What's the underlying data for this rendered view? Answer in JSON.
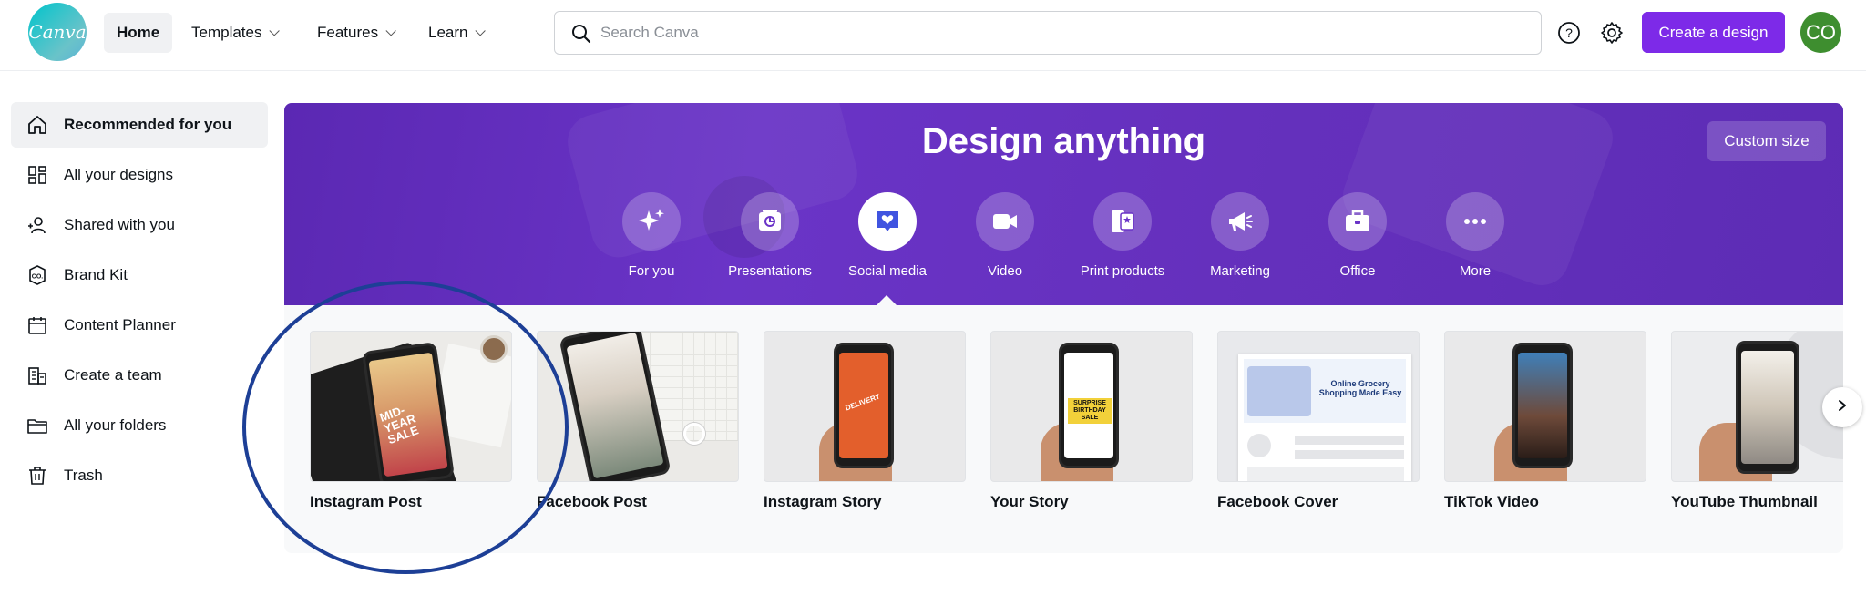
{
  "header": {
    "logo_text": "Canva",
    "nav": [
      {
        "label": "Home",
        "active": true,
        "dropdown": false
      },
      {
        "label": "Templates",
        "active": false,
        "dropdown": true
      },
      {
        "label": "Features",
        "active": false,
        "dropdown": true
      },
      {
        "label": "Learn",
        "active": false,
        "dropdown": true
      }
    ],
    "search_placeholder": "Search Canva",
    "create_label": "Create a design",
    "avatar_initials": "CO"
  },
  "sidebar": {
    "items": [
      {
        "label": "Recommended for you",
        "icon": "home-icon",
        "active": true
      },
      {
        "label": "All your designs",
        "icon": "grid-icon",
        "active": false
      },
      {
        "label": "Shared with you",
        "icon": "users-icon",
        "active": false
      },
      {
        "label": "Brand Kit",
        "icon": "brand-kit-icon",
        "active": false
      },
      {
        "label": "Content Planner",
        "icon": "calendar-icon",
        "active": false
      },
      {
        "label": "Create a team",
        "icon": "team-icon",
        "active": false
      },
      {
        "label": "All your folders",
        "icon": "folder-icon",
        "active": false
      },
      {
        "label": "Trash",
        "icon": "trash-icon",
        "active": false
      }
    ]
  },
  "hero": {
    "title": "Design anything",
    "custom_size_label": "Custom size",
    "categories": [
      {
        "label": "For you",
        "icon": "sparkle-icon",
        "active": false
      },
      {
        "label": "Presentations",
        "icon": "presentation-icon",
        "active": false
      },
      {
        "label": "Social media",
        "icon": "heart-chat-icon",
        "active": true
      },
      {
        "label": "Video",
        "icon": "video-camera-icon",
        "active": false
      },
      {
        "label": "Print products",
        "icon": "print-icon",
        "active": false
      },
      {
        "label": "Marketing",
        "icon": "megaphone-icon",
        "active": false
      },
      {
        "label": "Office",
        "icon": "briefcase-icon",
        "active": false
      },
      {
        "label": "More",
        "icon": "more-icon",
        "active": false
      }
    ]
  },
  "templates": {
    "items": [
      {
        "label": "Instagram Post",
        "overlay": "MID-YEAR SALE"
      },
      {
        "label": "Facebook Post"
      },
      {
        "label": "Instagram Story",
        "overlay": "DELIVERY"
      },
      {
        "label": "Your Story",
        "overlay": "SURPRISE BIRTHDAY SALE"
      },
      {
        "label": "Facebook Cover",
        "overlay": "Online Grocery Shopping Made Easy"
      },
      {
        "label": "TikTok Video"
      },
      {
        "label": "YouTube Thumbnail"
      }
    ]
  },
  "colors": {
    "brand_purple": "#7d2ae8",
    "hero_purple": "#6530bd",
    "annotation_circle": "#1d3f96",
    "avatar_green": "#3e8e2f"
  }
}
